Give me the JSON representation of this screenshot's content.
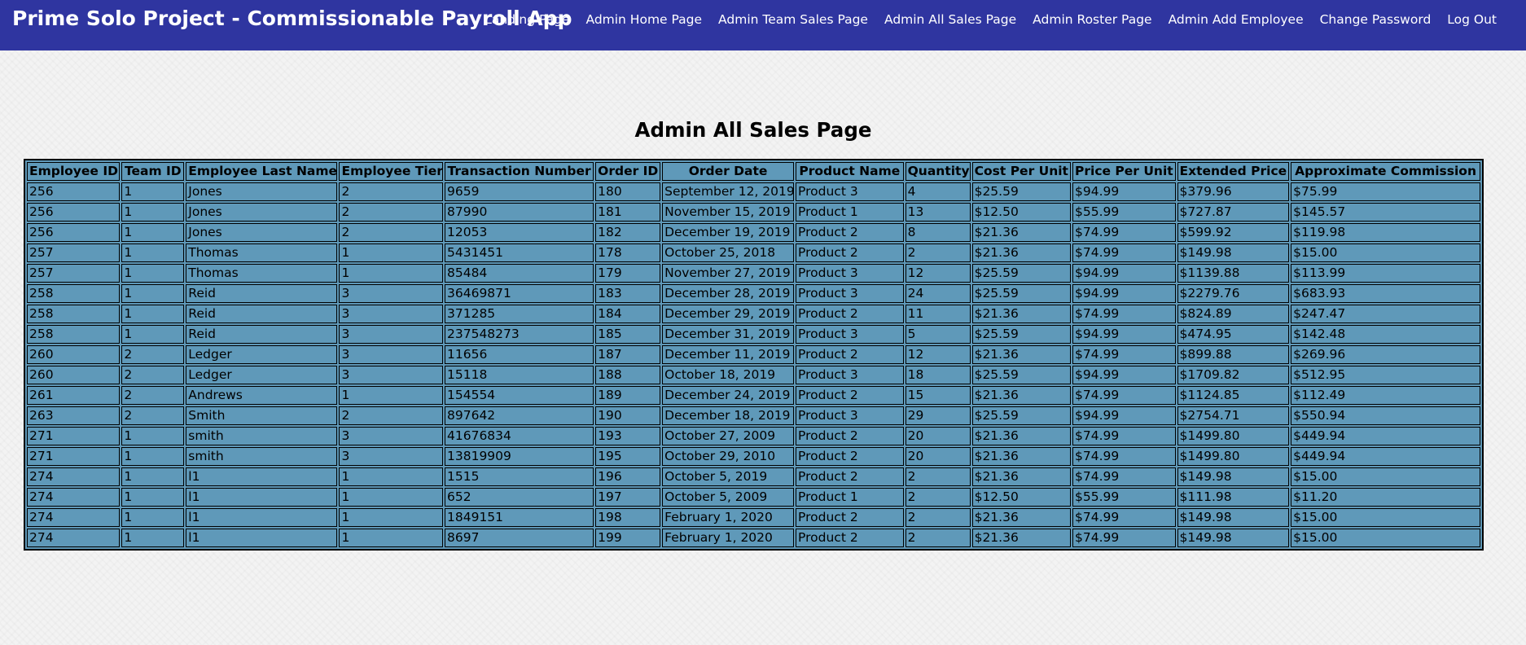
{
  "header": {
    "title": "Prime Solo Project - Commissionable Payroll App",
    "nav": [
      "Landing Page",
      "Admin Home Page",
      "Admin Team Sales Page",
      "Admin All Sales Page",
      "Admin Roster Page",
      "Admin Add Employee",
      "Change Password",
      "Log Out"
    ]
  },
  "page_title": "Admin All Sales Page",
  "table": {
    "columns": [
      "Employee ID",
      "Team ID",
      "Employee Last Name",
      "Employee Tier",
      "Transaction Number",
      "Order ID",
      "Order Date",
      "Product Name",
      "Quantity",
      "Cost Per Unit",
      "Price Per Unit",
      "Extended Price",
      "Approximate Commission"
    ],
    "rows": [
      [
        "256",
        "1",
        "Jones",
        "2",
        "9659",
        "180",
        "September 12, 2019",
        "Product 3",
        "4",
        "$25.59",
        "$94.99",
        "$379.96",
        "$75.99"
      ],
      [
        "256",
        "1",
        "Jones",
        "2",
        "87990",
        "181",
        "November 15, 2019",
        "Product 1",
        "13",
        "$12.50",
        "$55.99",
        "$727.87",
        "$145.57"
      ],
      [
        "256",
        "1",
        "Jones",
        "2",
        "12053",
        "182",
        "December 19, 2019",
        "Product 2",
        "8",
        "$21.36",
        "$74.99",
        "$599.92",
        "$119.98"
      ],
      [
        "257",
        "1",
        "Thomas",
        "1",
        "5431451",
        "178",
        "October 25, 2018",
        "Product 2",
        "2",
        "$21.36",
        "$74.99",
        "$149.98",
        "$15.00"
      ],
      [
        "257",
        "1",
        "Thomas",
        "1",
        "85484",
        "179",
        "November 27, 2019",
        "Product 3",
        "12",
        "$25.59",
        "$94.99",
        "$1139.88",
        "$113.99"
      ],
      [
        "258",
        "1",
        "Reid",
        "3",
        "36469871",
        "183",
        "December 28, 2019",
        "Product 3",
        "24",
        "$25.59",
        "$94.99",
        "$2279.76",
        "$683.93"
      ],
      [
        "258",
        "1",
        "Reid",
        "3",
        "371285",
        "184",
        "December 29, 2019",
        "Product 2",
        "11",
        "$21.36",
        "$74.99",
        "$824.89",
        "$247.47"
      ],
      [
        "258",
        "1",
        "Reid",
        "3",
        "237548273",
        "185",
        "December 31, 2019",
        "Product 3",
        "5",
        "$25.59",
        "$94.99",
        "$474.95",
        "$142.48"
      ],
      [
        "260",
        "2",
        "Ledger",
        "3",
        "11656",
        "187",
        "December 11, 2019",
        "Product 2",
        "12",
        "$21.36",
        "$74.99",
        "$899.88",
        "$269.96"
      ],
      [
        "260",
        "2",
        "Ledger",
        "3",
        "15118",
        "188",
        "October 18, 2019",
        "Product 3",
        "18",
        "$25.59",
        "$94.99",
        "$1709.82",
        "$512.95"
      ],
      [
        "261",
        "2",
        "Andrews",
        "1",
        "154554",
        "189",
        "December 24, 2019",
        "Product 2",
        "15",
        "$21.36",
        "$74.99",
        "$1124.85",
        "$112.49"
      ],
      [
        "263",
        "2",
        "Smith",
        "2",
        "897642",
        "190",
        "December 18, 2019",
        "Product 3",
        "29",
        "$25.59",
        "$94.99",
        "$2754.71",
        "$550.94"
      ],
      [
        "271",
        "1",
        "smith",
        "3",
        "41676834",
        "193",
        "October 27, 2009",
        "Product 2",
        "20",
        "$21.36",
        "$74.99",
        "$1499.80",
        "$449.94"
      ],
      [
        "271",
        "1",
        "smith",
        "3",
        "13819909",
        "195",
        "October 29, 2010",
        "Product 2",
        "20",
        "$21.36",
        "$74.99",
        "$1499.80",
        "$449.94"
      ],
      [
        "274",
        "1",
        "l1",
        "1",
        "1515",
        "196",
        "October 5, 2019",
        "Product 2",
        "2",
        "$21.36",
        "$74.99",
        "$149.98",
        "$15.00"
      ],
      [
        "274",
        "1",
        "l1",
        "1",
        "652",
        "197",
        "October 5, 2009",
        "Product 1",
        "2",
        "$12.50",
        "$55.99",
        "$111.98",
        "$11.20"
      ],
      [
        "274",
        "1",
        "l1",
        "1",
        "1849151",
        "198",
        "February 1, 2020",
        "Product 2",
        "2",
        "$21.36",
        "$74.99",
        "$149.98",
        "$15.00"
      ],
      [
        "274",
        "1",
        "l1",
        "1",
        "8697",
        "199",
        "February 1, 2020",
        "Product 2",
        "2",
        "$21.36",
        "$74.99",
        "$149.98",
        "$15.00"
      ]
    ]
  }
}
